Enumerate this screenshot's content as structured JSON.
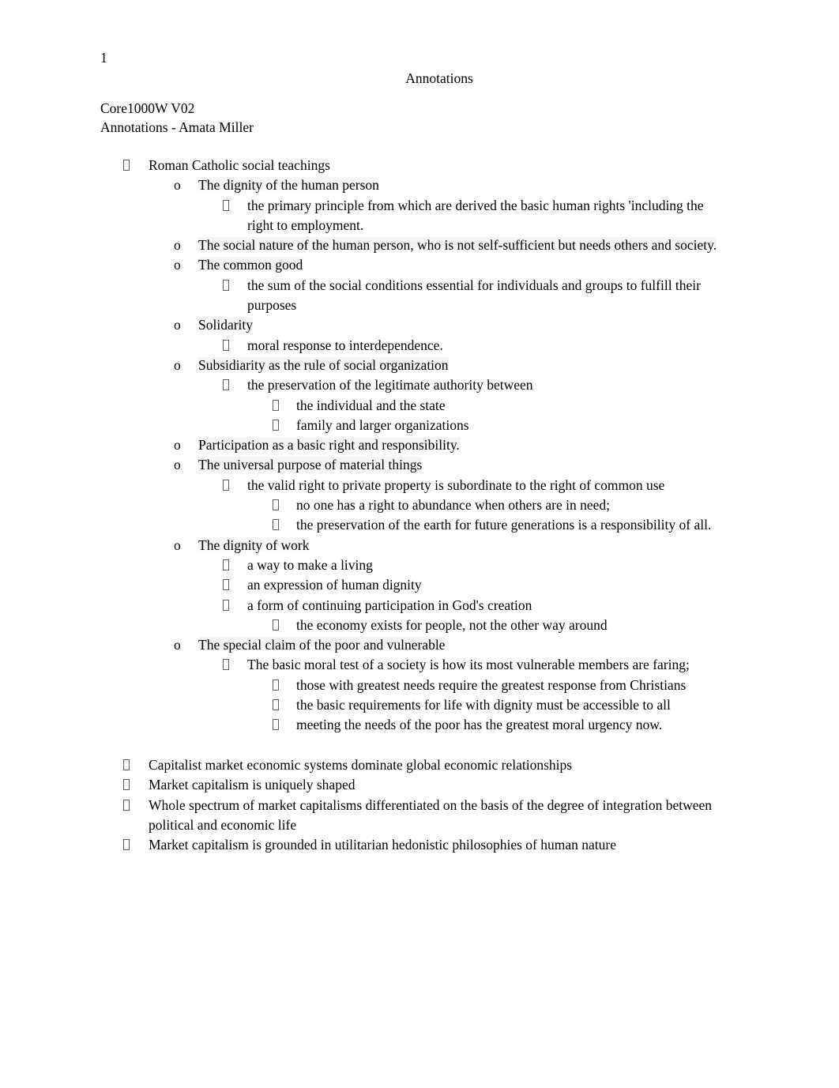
{
  "document": {
    "page_number": "1",
    "running_header": "Annotations",
    "title_lines": [
      "Core1000W V02",
      "Annotations - Amata Miller"
    ]
  },
  "markers": {
    "level1": "tofu-box",
    "level2": "o",
    "level3": "tofu-box",
    "level4": "tofu-box"
  },
  "outline": [
    {
      "level": 1,
      "text": "Roman Catholic social teachings",
      "shaded": false
    },
    {
      "level": 2,
      "text": "The dignity of the human person",
      "shaded": true
    },
    {
      "level": 3,
      "text": " the primary principle from which are derived the basic human rights 'including the right to employment.",
      "shaded": false
    },
    {
      "level": 2,
      "text": "The social nature of the human person, who is not self-sufficient but needs others and society.",
      "shaded": true
    },
    {
      "level": 2,
      "text": "The common good",
      "shaded": true
    },
    {
      "level": 3,
      "text": "the sum of the social conditions essential for individuals and groups to fulfill their purposes",
      "shaded": false
    },
    {
      "level": 2,
      "text": "Solidarity",
      "shaded": true
    },
    {
      "level": 3,
      "text": "moral response to interdependence.",
      "shaded": false
    },
    {
      "level": 2,
      "text": "Subsidiarity as the rule of social organization",
      "shaded": true
    },
    {
      "level": 3,
      "text": "the preservation of the legitimate authority between",
      "shaded": false
    },
    {
      "level": 4,
      "text": "the individual and the state",
      "shaded": false
    },
    {
      "level": 4,
      "text": "family and larger organizations",
      "shaded": false
    },
    {
      "level": 2,
      "text": "Participation as a basic right and responsibility.",
      "shaded": true
    },
    {
      "level": 2,
      "text": "The universal purpose of material things",
      "shaded": true
    },
    {
      "level": 3,
      "text": "the valid right to private property is subordinate to the right of common use",
      "shaded": false
    },
    {
      "level": 4,
      "text": "no one has a right to abundance when others are in need;",
      "shaded": false
    },
    {
      "level": 4,
      "text": "the preservation of the earth for future generations is a responsibility of all.",
      "shaded": false
    },
    {
      "level": 2,
      "text": "The dignity of work",
      "shaded": true
    },
    {
      "level": 3,
      "text": "a way to make a living",
      "shaded": false
    },
    {
      "level": 3,
      "text": "an expression of human dignity",
      "shaded": false
    },
    {
      "level": 3,
      "text": "a form of continuing participation in God's creation",
      "shaded": false
    },
    {
      "level": 4,
      "text": "the economy exists for people, not the other way around",
      "shaded": false
    },
    {
      "level": 2,
      "text": "The special claim of the poor and vulnerable",
      "shaded": true
    },
    {
      "level": 3,
      "text": "The basic moral test of a society is how its most vulnerable members are faring;",
      "shaded": false
    },
    {
      "level": 4,
      "text": "those with greatest needs require the greatest response from Christians",
      "shaded": false
    },
    {
      "level": 4,
      "text": "the basic requirements for life with dignity must be accessible to all",
      "shaded": false
    },
    {
      "level": 4,
      "text": "meeting the needs of the poor has the greatest moral urgency now.",
      "shaded": false
    },
    {
      "level": 0,
      "text": "",
      "shaded": false
    },
    {
      "level": 1,
      "text": "Capitalist market economic systems dominate global economic relationships",
      "shaded": false
    },
    {
      "level": 1,
      "text": "Market capitalism is uniquely shaped",
      "shaded": false
    },
    {
      "level": 1,
      "text": "Whole spectrum of market capitalisms differentiated on the basis of the degree of integration between political and economic life",
      "shaded": false
    },
    {
      "level": 1,
      "text": "Market capitalism is grounded in utilitarian hedonistic philosophies of human nature",
      "shaded": false
    }
  ]
}
